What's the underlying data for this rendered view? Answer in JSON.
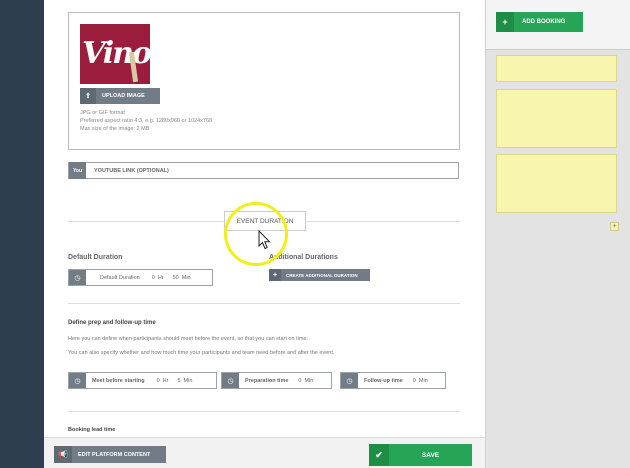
{
  "image_upload": {
    "logo_text": "Vino",
    "upload_label": "UPLOAD IMAGE",
    "hint_format": "JPG or GIF format",
    "hint_ratio": "Preferred aspect ratio 4:3, e.g. 1280x960 or 1024x768",
    "hint_size": "Max size of the image: 2 MB"
  },
  "youtube": {
    "icon_text": "You",
    "label": "YOUTUBE LINK (OPTIONAL)"
  },
  "section_tab": "EVENT DURATION",
  "default_duration": {
    "heading": "Default Duration",
    "field_label": "Default Duration",
    "hours": "0",
    "hr_unit": "Hr",
    "minutes": "50",
    "min_unit": "Min"
  },
  "additional_durations": {
    "heading": "Additional Durations",
    "button_label": "CREATE ADDITIONAL DURATION"
  },
  "prep": {
    "heading": "Define prep and follow-up time",
    "line1": "Here you can define when participants should meet before the event, so that you can start on time.",
    "line2": "You can also specify whether and how much time your participants and team need before and after the event.",
    "meet": {
      "label": "Meet before starting",
      "hours": "0",
      "hr_unit": "Hr",
      "minutes": "5",
      "min_unit": "Min"
    },
    "preparation": {
      "label": "Preparation time",
      "minutes": "0",
      "min_unit": "Min"
    },
    "followup": {
      "label": "Follow-up time",
      "minutes": "0",
      "min_unit": "Min"
    }
  },
  "lead": {
    "heading": "Booking lead time"
  },
  "bottom": {
    "edit_label": "EDIT PLATFORM CONTENT",
    "save_label": "SAVE"
  },
  "right_panel": {
    "add_booking_label": "ADD BOOKING",
    "plus": "+"
  },
  "colors": {
    "accent_green": "#27a556",
    "sidebar": "#2e3e4e",
    "button_gray": "#727c86",
    "note_yellow": "#f8f6ae",
    "highlight_yellow": "#f2ee1c"
  }
}
